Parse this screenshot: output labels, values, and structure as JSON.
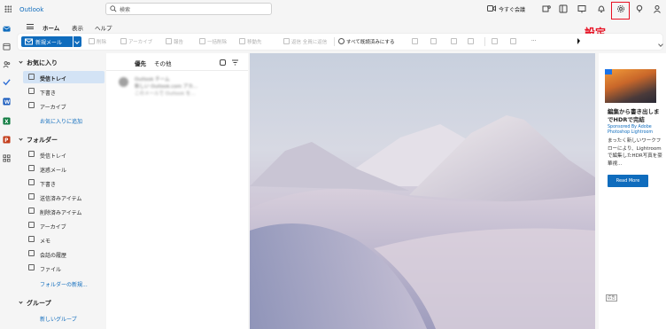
{
  "app": {
    "brand": "Outlook",
    "search_placeholder": "検索",
    "meet_now": "今すぐ会議"
  },
  "annotation": {
    "settings_label": "設定",
    "color": "#e81123"
  },
  "ribbon": {
    "tabs": [
      "ホーム",
      "表示",
      "ヘルプ"
    ],
    "new_mail": "新規メール",
    "buttons": [
      "削除",
      "アーカイブ",
      "報告",
      "一括削除",
      "移動先",
      "返信 全員に返信"
    ],
    "mark_all_read": "すべて既読済みにする",
    "more": "···"
  },
  "sidebar": {
    "favorites_title": "お気に入り",
    "favorites": [
      "受信トレイ",
      "下書き",
      "アーカイブ"
    ],
    "add_favorite": "お気に入りに追加",
    "folders_title": "フォルダー",
    "folders": [
      "受信トレイ",
      "迷惑メール",
      "下書き",
      "送信済みアイテム",
      "削除済みアイテム",
      "アーカイブ",
      "メモ",
      "会話の履歴",
      "ファイル"
    ],
    "new_folder": "フォルダーの新規...",
    "groups_title": "グループ",
    "new_group": "新しいグループ"
  },
  "mail_list": {
    "tabs": [
      "優先",
      "その他"
    ],
    "message": {
      "sender": "Outlook チーム",
      "subject": "新しい Outlook.com アカ...",
      "preview": "このメールで Outlook を..."
    }
  },
  "ad": {
    "headline": "編集から書き出しまでHDRで完結",
    "sponsor": "Sponsored By Adobe Photoshop Lightroom",
    "body": "まったく新しいワークフローにより、Lightroomで編集したHDR写真を豪華視...",
    "cta": "Read More",
    "choices": "広告"
  },
  "colors": {
    "accent": "#0f6cbd",
    "selected_bg": "#d3e3f5"
  }
}
